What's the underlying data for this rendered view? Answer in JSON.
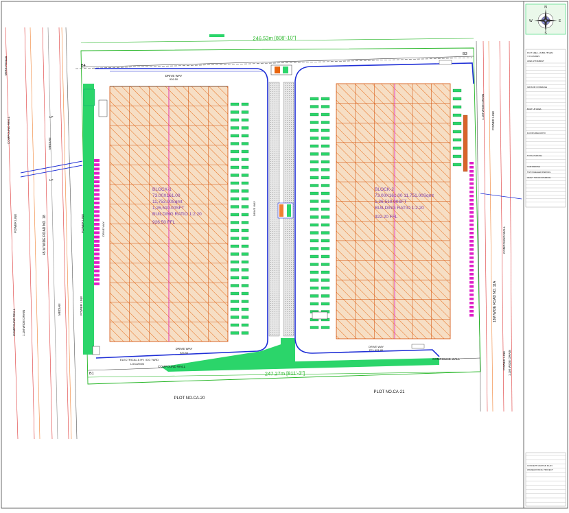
{
  "dimensions": {
    "top": "246.53m [808'-10\"]",
    "bottom": "247.27m [811'-3\"]",
    "left_road": "45 M WIDE ROAD NO. 18",
    "right_road": "18M WIDE ROAD NO. 11A"
  },
  "corners": {
    "b1": "B1",
    "b3": "B3",
    "b4": "B4"
  },
  "plots": {
    "left": "PLOT NO.CA-20",
    "right": "PLOT NO.CA-21"
  },
  "roads": {
    "wire_fence": "WIRE FENCE",
    "compound_wall": "COMPOUND WALL",
    "power_line": "POWER LINE",
    "median": "MEDIAN",
    "lp": "LP",
    "drain": "1.1M WIDE DRAIN",
    "electrical": "ELECTRICAL & HV / DG YARD",
    "location": "LOCATION"
  },
  "blocks": {
    "block1": {
      "name": "BLOCK-1",
      "size": "73.00X161.00",
      "area": "11,753.00Sqmt",
      "sft": "1,26,510.00SFT",
      "ratio": "BUILDING RATIO 1:2.20",
      "ffl": "926.50 FFL"
    },
    "block2": {
      "name": "BLOCK-2",
      "size": "73.00X161.00  11,751.00Sqmt",
      "sft": "1,26,510.00SFT",
      "ratio": "BUILDING RATIO 1:2.20",
      "ffl": "922.20 FFL"
    }
  },
  "driveways": {
    "drive_way": "DRIVE WAY",
    "drive_top_left_level": "926.50",
    "drive_bottom_left_level": "926.50",
    "drive_bottom_right": "DRIVE WAY",
    "drive_bottom_right_level": "FFL 921.80"
  },
  "title_block": {
    "north": "N",
    "south": "S",
    "east": "E",
    "west": "W",
    "lines": [
      "PLOT AREA - 26,881.78 SQM",
      "= 6.64 ACRES",
      "AREA STATEMENT",
      "GROUND COVERAGE",
      "BUILT UP AREA",
      "FLOOR AREA RATIO",
      "TOTAL PARKING",
      "CAR PARKING",
      "TWO WHEELER PARKING",
      "HEAVY TRUCKS PARKING"
    ],
    "project": "CONCEPT MASTER PLAN",
    "subtitle": "WAREHOUSING PROJECT"
  },
  "colors": {
    "hatch": "#e8640c",
    "building_fill": "#f5dcc0",
    "setback_line": "#23b523",
    "blue_road": "#1f2fd6",
    "magenta": "#e020c8",
    "docks_green": "#2bd56a"
  }
}
